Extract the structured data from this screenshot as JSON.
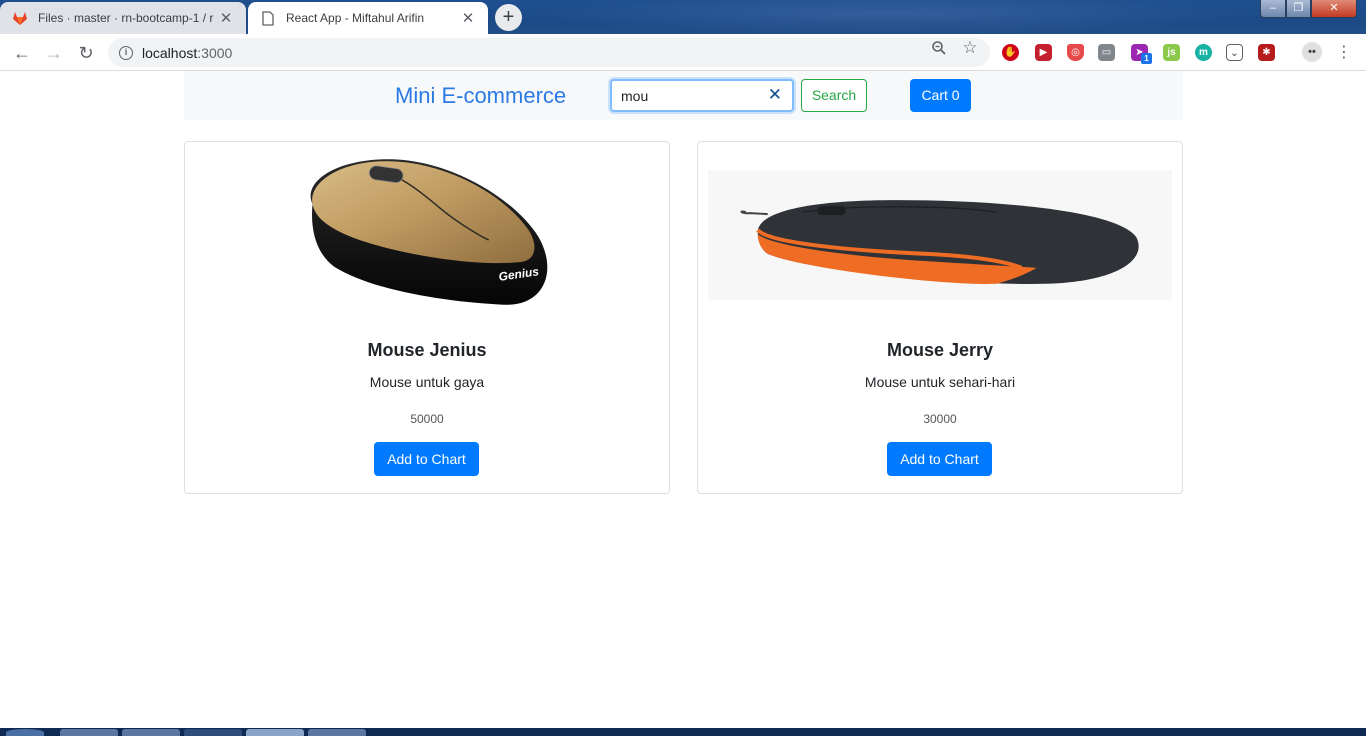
{
  "browser": {
    "tabs": [
      {
        "title": "Files · master · rn-bootcamp-1 / r",
        "close": "✕",
        "favicon": "gitlab-icon"
      },
      {
        "title": "React App - Miftahul Arifin",
        "close": "✕",
        "favicon": "page-icon"
      }
    ],
    "new_tab": "+",
    "url_host": "localhost",
    "url_port": ":3000"
  },
  "header": {
    "brand": "Mini E-commerce",
    "search_value": "mou",
    "clear_icon": "✕",
    "search_button": "Search",
    "cart_button": "Cart 0"
  },
  "products": [
    {
      "name": "Mouse Jenius",
      "description": "Mouse untuk gaya",
      "price": "50000",
      "button": "Add to Chart",
      "logo_text": "Genius"
    },
    {
      "name": "Mouse Jerry",
      "description": "Mouse untuk sehari-hari",
      "price": "30000",
      "button": "Add to Chart"
    }
  ],
  "colors": {
    "primary": "#007bff",
    "success": "#28a745",
    "brand": "#2c7be5",
    "accent_orange": "#ef6c24",
    "gold": "#c9a66b"
  }
}
